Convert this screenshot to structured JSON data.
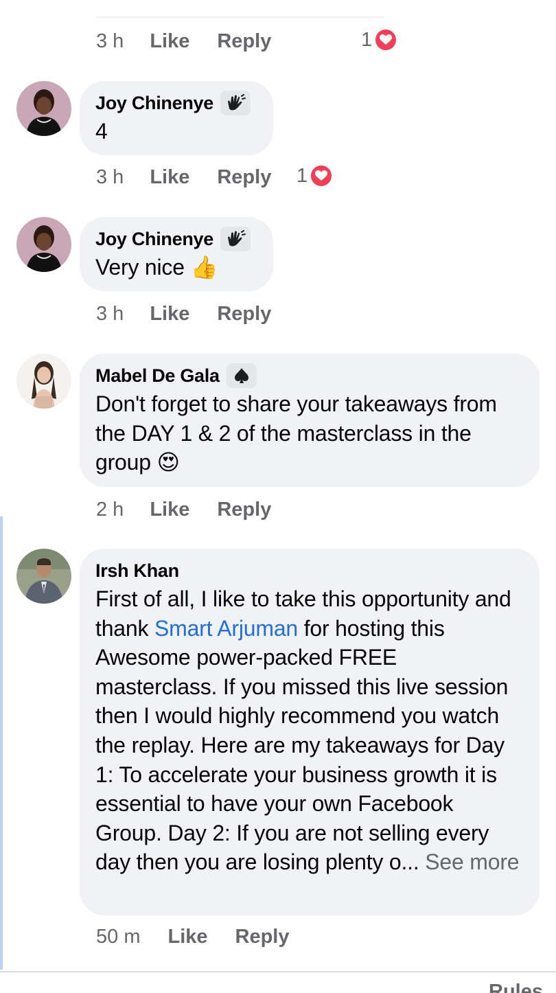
{
  "top_comment_actions": {
    "time": "3 h",
    "like": "Like",
    "reply": "Reply",
    "reaction_count": "1"
  },
  "comments": [
    {
      "author": "Joy Chinenye",
      "badge_icon": "waving-hand-badge-icon",
      "text": "4",
      "time": "3 h",
      "like": "Like",
      "reply": "Reply",
      "reaction_count": "1"
    },
    {
      "author": "Joy Chinenye",
      "badge_icon": "waving-hand-badge-icon",
      "text": "Very nice",
      "emoji": "👍",
      "time": "3 h",
      "like": "Like",
      "reply": "Reply"
    },
    {
      "author": "Mabel De Gala",
      "badge_icon": "spade-badge-icon",
      "text": "Don't forget to share your takeaways from the DAY 1 & 2 of the masterclass  in the group",
      "emoji": "😍",
      "time": "2 h",
      "like": "Like",
      "reply": "Reply"
    },
    {
      "author": "Irsh Khan",
      "text_before_mention": "First of all, I like to take this opportunity and thank ",
      "mention": "Smart Arjuman",
      "text_after_mention": " for hosting this Awesome power-packed FREE masterclass. If you missed this live session then I would highly recommend you watch the replay.  Here are my takeaways for Day 1:  To accelerate your business growth it is essential to have your own Facebook Group.   Day 2:  If you are not selling every day then you are losing plenty o...",
      "see_more": "See more",
      "time": "50 m",
      "like": "Like",
      "reply": "Reply"
    }
  ],
  "footer": {
    "rules": "Rules"
  },
  "colors": {
    "bubble": "#f0f2f5",
    "meta_text": "#65676b",
    "mention": "#216fdb",
    "heart": "#f33e58"
  }
}
